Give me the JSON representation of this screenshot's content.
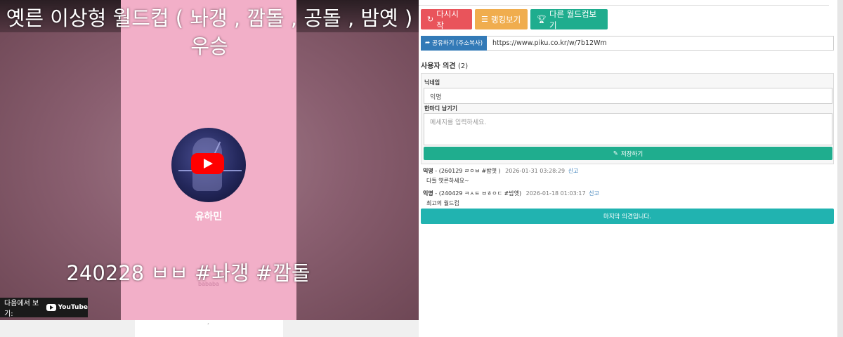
{
  "video": {
    "title": "옛른 이상형 월드컵 ( 놔갱 , 깜돌 , 공돌 , 밤옛 )  우승",
    "artist": "유하민",
    "small_mark": "bababa",
    "subtitle": "240228 ㅂㅂ #놔갱 #깜돌",
    "watch_on": "다음에서 보기:",
    "youtube": "YouTube"
  },
  "buttons": {
    "restart": "다시시작",
    "ranking": "랭킹보기",
    "other": "다른 월드컵보기"
  },
  "share": {
    "button": "공유하기 (주소복사)",
    "url": "https://www.piku.co.kr/w/7b12Wm"
  },
  "opinions": {
    "heading": "사용자 의견",
    "count": "(2)"
  },
  "form": {
    "nickname_label": "닉네임",
    "nickname_value": "익명",
    "message_label": "한마디 남기기",
    "message_placeholder": "메세지를 입력하세요.",
    "save": "저장하기"
  },
  "comments": [
    {
      "author": "익명",
      "meta": "- (260129 ㄹㅇㅂ #밤옛 )",
      "date": "2026-01-31 03:28:29",
      "report": "신고",
      "text": "다들 옛른하세요~"
    },
    {
      "author": "익명",
      "meta": "- (240429 ㅋㅅㅌ ㅂㅎㅇㄷ #밤옛)",
      "date": "2026-01-18 01:03:17",
      "report": "신고",
      "text": "최고의 월드컵"
    }
  ],
  "last_button": "마지막 의견입니다.",
  "colors": {
    "red": "#e9545b",
    "orange": "#f0ad4e",
    "green": "#1fad8e",
    "blue": "#337ab7",
    "teal": "#21b3b0"
  },
  "icons": [
    "refresh-icon",
    "list-icon",
    "trophy-icon",
    "share-icon",
    "pencil-icon",
    "youtube-icon",
    "play-icon"
  ]
}
